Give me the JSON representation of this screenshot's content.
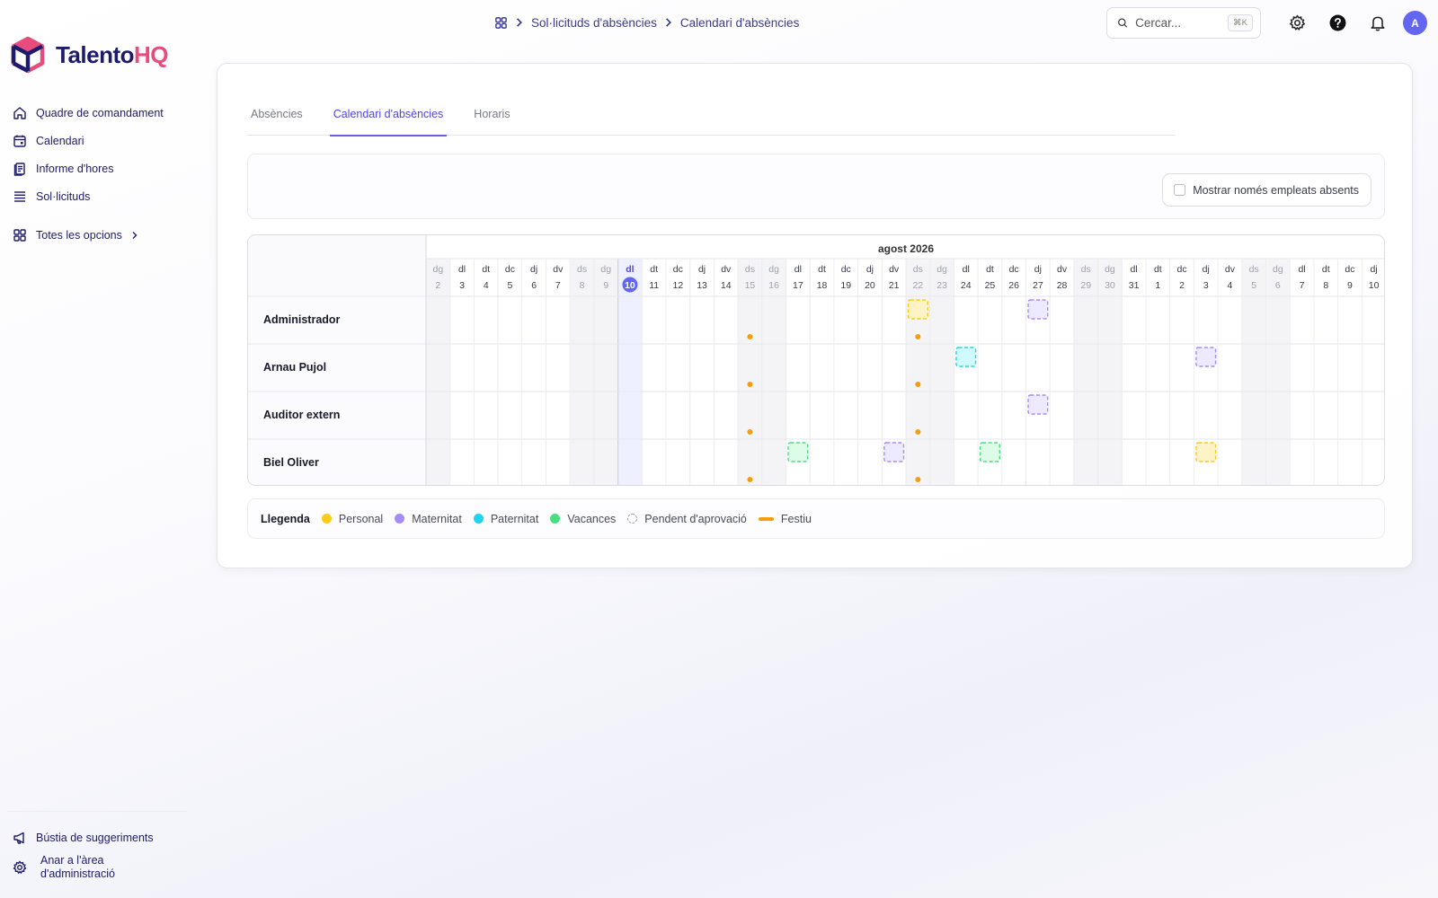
{
  "app": {
    "logo_prefix": "Talento",
    "logo_suffix": "HQ"
  },
  "sidebar": {
    "items": [
      {
        "label": "Quadre de comandament",
        "icon": "home-icon"
      },
      {
        "label": "Calendari",
        "icon": "calendar-icon"
      },
      {
        "label": "Informe d'hores",
        "icon": "report-icon"
      },
      {
        "label": "Sol·licituds",
        "icon": "list-icon"
      }
    ],
    "all_options": "Totes les opcions",
    "bottom": [
      {
        "label": "Bústia de suggeriments",
        "icon": "megaphone-icon"
      },
      {
        "label_line1": "Anar a l'àrea",
        "label_line2": "d'administració",
        "icon": "gear-icon"
      }
    ]
  },
  "header": {
    "breadcrumb": [
      "Sol·licituds d'absències",
      "Calendari d'absències"
    ],
    "search_placeholder": "Cercar...",
    "search_shortcut": "⌘K",
    "avatar_initial": "A"
  },
  "tabs": [
    {
      "label": "Absències",
      "active": false
    },
    {
      "label": "Calendari d'absències",
      "active": true
    },
    {
      "label": "Horaris",
      "active": false
    }
  ],
  "filter": {
    "toggle_label": "Mostrar només empleats absents"
  },
  "calendar": {
    "month_label": "agost 2026",
    "today_index": 8,
    "days": [
      {
        "dow": "dg",
        "d": "2",
        "weekend": true
      },
      {
        "dow": "dl",
        "d": "3"
      },
      {
        "dow": "dt",
        "d": "4"
      },
      {
        "dow": "dc",
        "d": "5"
      },
      {
        "dow": "dj",
        "d": "6"
      },
      {
        "dow": "dv",
        "d": "7"
      },
      {
        "dow": "ds",
        "d": "8",
        "weekend": true
      },
      {
        "dow": "dg",
        "d": "9",
        "weekend": true
      },
      {
        "dow": "dl",
        "d": "10"
      },
      {
        "dow": "dt",
        "d": "11"
      },
      {
        "dow": "dc",
        "d": "12"
      },
      {
        "dow": "dj",
        "d": "13"
      },
      {
        "dow": "dv",
        "d": "14"
      },
      {
        "dow": "ds",
        "d": "15",
        "weekend": true,
        "holiday": true
      },
      {
        "dow": "dg",
        "d": "16",
        "weekend": true
      },
      {
        "dow": "dl",
        "d": "17"
      },
      {
        "dow": "dt",
        "d": "18"
      },
      {
        "dow": "dc",
        "d": "19"
      },
      {
        "dow": "dj",
        "d": "20"
      },
      {
        "dow": "dv",
        "d": "21"
      },
      {
        "dow": "ds",
        "d": "22",
        "weekend": true,
        "holiday": true
      },
      {
        "dow": "dg",
        "d": "23",
        "weekend": true
      },
      {
        "dow": "dl",
        "d": "24"
      },
      {
        "dow": "dt",
        "d": "25"
      },
      {
        "dow": "dc",
        "d": "26"
      },
      {
        "dow": "dj",
        "d": "27"
      },
      {
        "dow": "dv",
        "d": "28"
      },
      {
        "dow": "ds",
        "d": "29",
        "weekend": true
      },
      {
        "dow": "dg",
        "d": "30",
        "weekend": true
      },
      {
        "dow": "dl",
        "d": "31"
      },
      {
        "dow": "dt",
        "d": "1"
      },
      {
        "dow": "dc",
        "d": "2"
      },
      {
        "dow": "dj",
        "d": "3"
      },
      {
        "dow": "dv",
        "d": "4"
      },
      {
        "dow": "ds",
        "d": "5",
        "weekend": true
      },
      {
        "dow": "dg",
        "d": "6",
        "weekend": true
      },
      {
        "dow": "dl",
        "d": "7"
      },
      {
        "dow": "dt",
        "d": "8"
      },
      {
        "dow": "dc",
        "d": "9"
      },
      {
        "dow": "dj",
        "d": "10"
      }
    ],
    "employees": [
      {
        "name": "Administrador",
        "absences": [
          {
            "day_index": 20,
            "type": "personal"
          },
          {
            "day_index": 25,
            "type": "maternitat"
          }
        ]
      },
      {
        "name": "Arnau Pujol",
        "absences": [
          {
            "day_index": 22,
            "type": "paternitat"
          },
          {
            "day_index": 32,
            "type": "maternitat"
          }
        ]
      },
      {
        "name": "Auditor extern",
        "absences": [
          {
            "day_index": 25,
            "type": "maternitat"
          }
        ]
      },
      {
        "name": "Biel Oliver",
        "absences": [
          {
            "day_index": 15,
            "type": "vacances"
          },
          {
            "day_index": 19,
            "type": "maternitat"
          },
          {
            "day_index": 23,
            "type": "vacances"
          },
          {
            "day_index": 32,
            "type": "personal"
          }
        ]
      }
    ]
  },
  "legend": {
    "title": "Llegenda",
    "items": [
      {
        "label": "Personal",
        "kind": "dot",
        "color": "#facc15"
      },
      {
        "label": "Maternitat",
        "kind": "dot",
        "color": "#a78bfa"
      },
      {
        "label": "Paternitat",
        "kind": "dot",
        "color": "#22d3ee"
      },
      {
        "label": "Vacances",
        "kind": "dot",
        "color": "#4ade80"
      },
      {
        "label": "Pendent d'aprovació",
        "kind": "pending",
        "color": "#9a9aaa"
      },
      {
        "label": "Festiu",
        "kind": "bar",
        "color": "#f59e0b"
      }
    ]
  },
  "colors": {
    "accent": "#6366f1",
    "personal_fill": "#fef3c7",
    "personal_stroke": "#facc15",
    "maternitat_fill": "#ede9fe",
    "maternitat_stroke": "#a78bfa",
    "paternitat_fill": "#cffafe",
    "paternitat_stroke": "#22d3ee",
    "vacances_fill": "#dcfce7",
    "vacances_stroke": "#4ade80",
    "holiday": "#f59e0b"
  }
}
